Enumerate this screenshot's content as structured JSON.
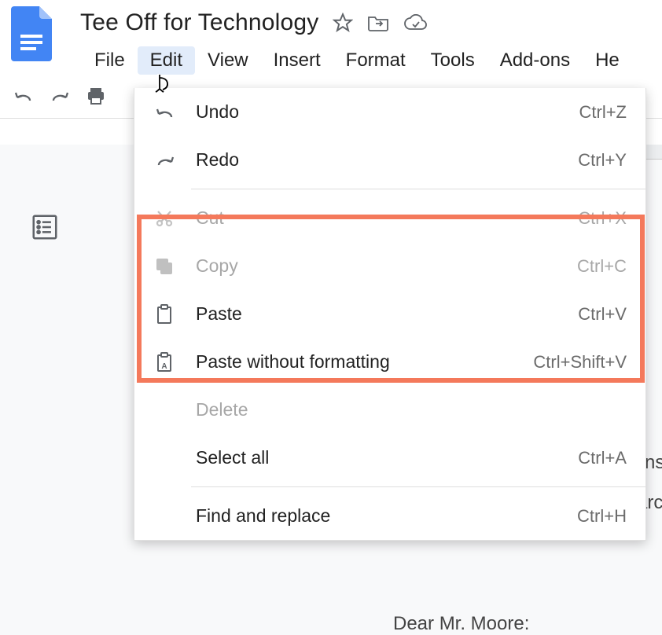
{
  "doc": {
    "title": "Tee Off for Technology"
  },
  "menubar": {
    "file": "File",
    "edit": "Edit",
    "view": "View",
    "insert": "Insert",
    "format": "Format",
    "tools": "Tools",
    "addons": "Add-ons",
    "help": "He"
  },
  "edit_menu": {
    "undo": {
      "label": "Undo",
      "shortcut": "Ctrl+Z"
    },
    "redo": {
      "label": "Redo",
      "shortcut": "Ctrl+Y"
    },
    "cut": {
      "label": "Cut",
      "shortcut": "Ctrl+X"
    },
    "copy": {
      "label": "Copy",
      "shortcut": "Ctrl+C"
    },
    "paste": {
      "label": "Paste",
      "shortcut": "Ctrl+V"
    },
    "paste_without_formatting": {
      "label": "Paste without formatting",
      "shortcut": "Ctrl+Shift+V"
    },
    "delete": {
      "label": "Delete",
      "shortcut": ""
    },
    "select_all": {
      "label": "Select all",
      "shortcut": "Ctrl+A"
    },
    "find_replace": {
      "label": "Find and replace",
      "shortcut": "Ctrl+H"
    }
  },
  "document_body": {
    "fragment1": "ns",
    "fragment2": "arc",
    "fragment3": "Dear Mr. Moore:"
  }
}
